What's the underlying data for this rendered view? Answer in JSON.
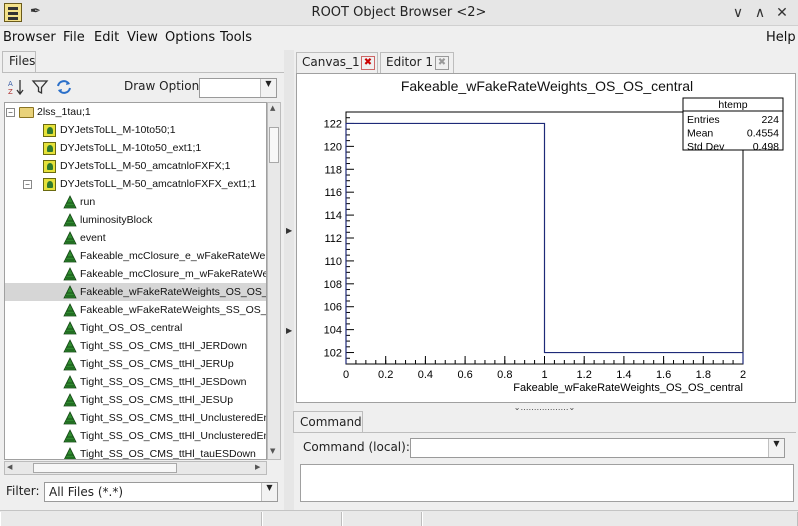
{
  "window": {
    "title": "ROOT Object Browser <2>"
  },
  "menu": [
    "Browser",
    "File",
    "Edit",
    "View",
    "Options",
    "Tools",
    "Help"
  ],
  "left_panel": {
    "tab": "Files",
    "draw_option_label": "Draw Option:",
    "draw_option_value": "",
    "filter_label": "Filter:",
    "filter_value": "All Files (*.*)"
  },
  "tree": [
    {
      "label": "2lss_1tau;1",
      "kind": "folder",
      "level": 0,
      "expanded": true
    },
    {
      "label": "DYJetsToLL_M-10to50;1",
      "kind": "tree",
      "level": 1
    },
    {
      "label": "DYJetsToLL_M-10to50_ext1;1",
      "kind": "tree",
      "level": 1
    },
    {
      "label": "DYJetsToLL_M-50_amcatnloFXFX;1",
      "kind": "tree",
      "level": 1
    },
    {
      "label": "DYJetsToLL_M-50_amcatnloFXFX_ext1;1",
      "kind": "tree",
      "level": 1,
      "expanded": true
    },
    {
      "label": "run",
      "kind": "leaf",
      "level": 2
    },
    {
      "label": "luminosityBlock",
      "kind": "leaf",
      "level": 2
    },
    {
      "label": "event",
      "kind": "leaf",
      "level": 2
    },
    {
      "label": "Fakeable_mcClosure_e_wFakeRateWeig",
      "kind": "leaf",
      "level": 2
    },
    {
      "label": "Fakeable_mcClosure_m_wFakeRateWeig",
      "kind": "leaf",
      "level": 2
    },
    {
      "label": "Fakeable_wFakeRateWeights_OS_OS_c",
      "kind": "leaf",
      "level": 2,
      "selected": true
    },
    {
      "label": "Fakeable_wFakeRateWeights_SS_OS_c",
      "kind": "leaf",
      "level": 2
    },
    {
      "label": "Tight_OS_OS_central",
      "kind": "leaf",
      "level": 2
    },
    {
      "label": "Tight_SS_OS_CMS_ttHl_JERDown",
      "kind": "leaf",
      "level": 2
    },
    {
      "label": "Tight_SS_OS_CMS_ttHl_JERUp",
      "kind": "leaf",
      "level": 2
    },
    {
      "label": "Tight_SS_OS_CMS_ttHl_JESDown",
      "kind": "leaf",
      "level": 2
    },
    {
      "label": "Tight_SS_OS_CMS_ttHl_JESUp",
      "kind": "leaf",
      "level": 2
    },
    {
      "label": "Tight_SS_OS_CMS_ttHl_UnclusteredEnD",
      "kind": "leaf",
      "level": 2
    },
    {
      "label": "Tight_SS_OS_CMS_ttHl_UnclusteredEnU",
      "kind": "leaf",
      "level": 2
    },
    {
      "label": "Tight_SS_OS_CMS_ttHl_tauESDown",
      "kind": "leaf",
      "level": 2
    }
  ],
  "canvas_tabs": [
    {
      "label": "Canvas_1",
      "active": true
    },
    {
      "label": "Editor 1",
      "active": false
    }
  ],
  "chart_data": {
    "type": "bar",
    "title": "Fakeable_wFakeRateWeights_OS_OS_central",
    "xlabel": "Fakeable_wFakeRateWeights_OS_OS_central",
    "ylabel": "",
    "xlim": [
      0,
      2
    ],
    "ylim": [
      101,
      123
    ],
    "bins": [
      {
        "x0": 0,
        "x1": 1,
        "value": 122
      },
      {
        "x0": 1,
        "x1": 2,
        "value": 102
      }
    ],
    "xticks": [
      "0",
      "0.2",
      "0.4",
      "0.6",
      "0.8",
      "1",
      "1.2",
      "1.4",
      "1.6",
      "1.8",
      "2"
    ],
    "yticks": [
      "102",
      "104",
      "106",
      "108",
      "110",
      "112",
      "114",
      "116",
      "118",
      "120",
      "122"
    ],
    "stats": {
      "name": "htemp",
      "rows": [
        {
          "label": "Entries",
          "value": "224"
        },
        {
          "label": "Mean",
          "value": "0.4554"
        },
        {
          "label": "Std Dev",
          "value": "0.498"
        }
      ]
    },
    "line_color": "#1e2a78"
  },
  "command": {
    "tab": "Command",
    "label": "Command (local):",
    "value": ""
  }
}
